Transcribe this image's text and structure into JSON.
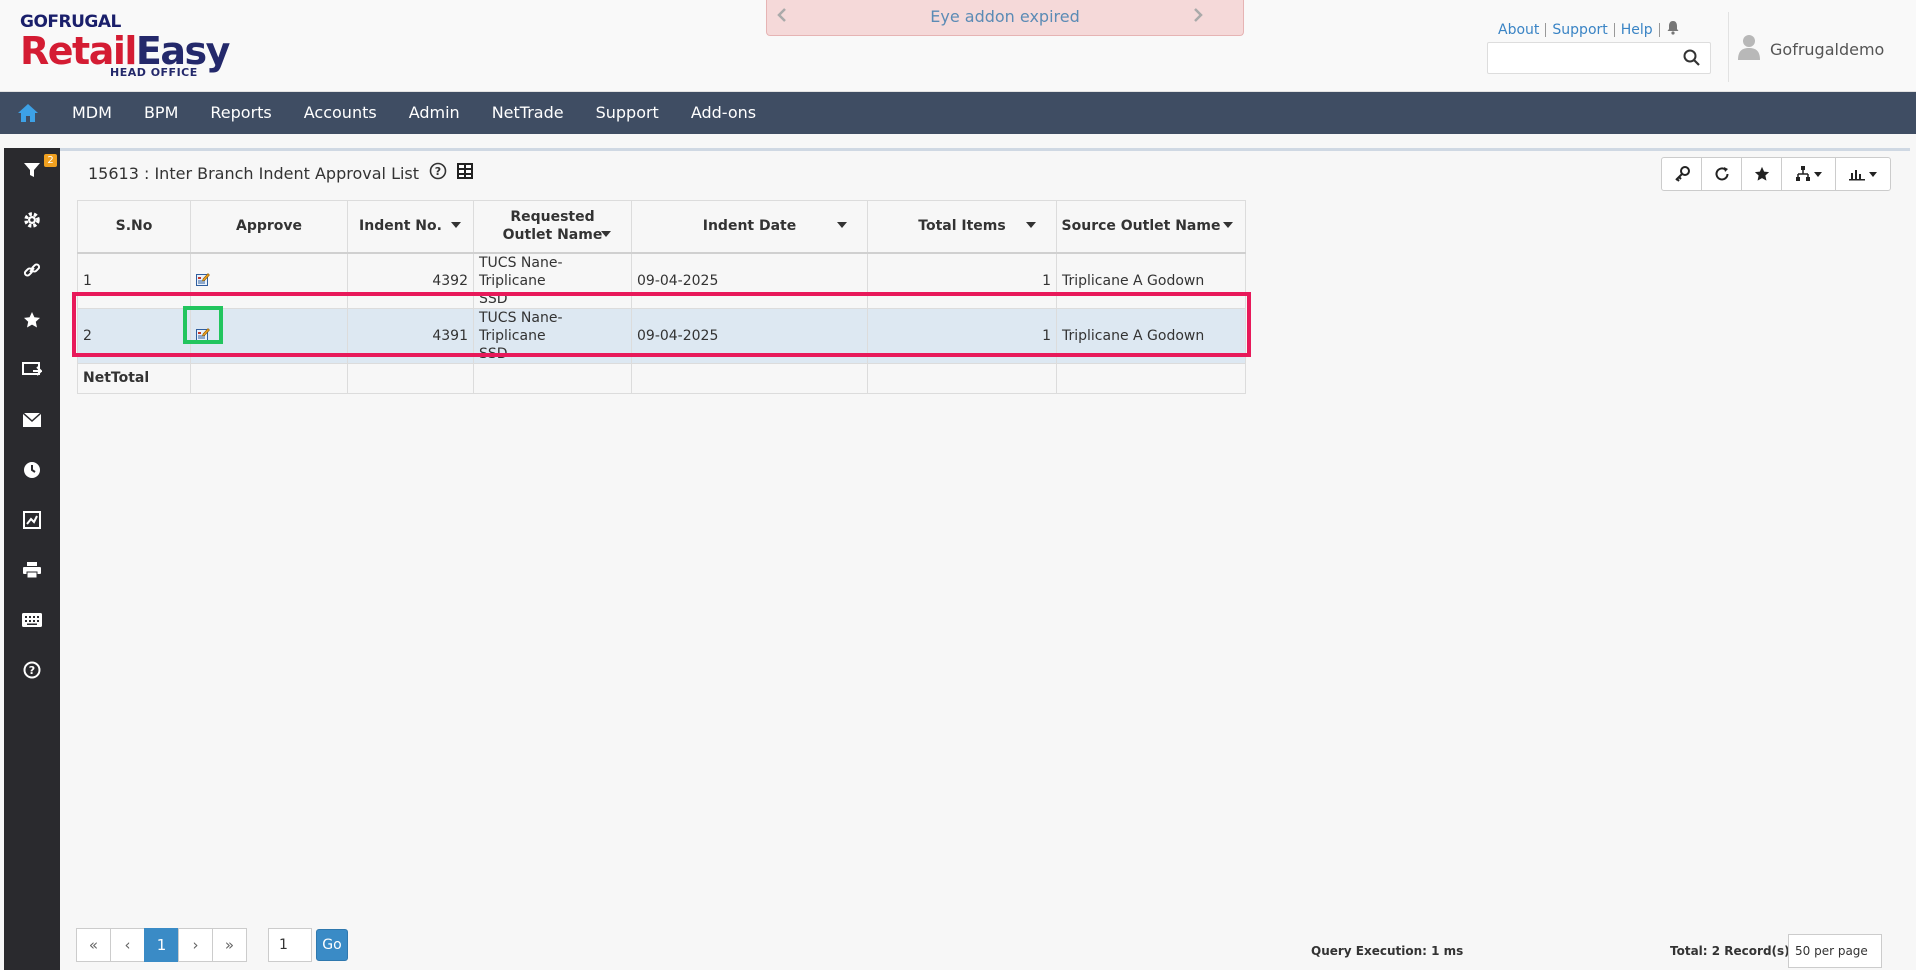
{
  "header": {
    "logo_brand": "GOFRUGAL",
    "logo_retail": "Retail",
    "logo_easy": "Easy",
    "logo_sub": "HEAD OFFICE",
    "notice": "Eye addon expired",
    "links": [
      "About",
      "Support",
      "Help"
    ],
    "search_placeholder": "",
    "username": "Gofrugaldemo"
  },
  "nav": {
    "items": [
      "MDM",
      "BPM",
      "Reports",
      "Accounts",
      "Admin",
      "NetTrade",
      "Support",
      "Add-ons"
    ]
  },
  "sidebar": {
    "filter_badge": "2"
  },
  "page": {
    "title": "15613 : Inter Branch Indent Approval List"
  },
  "table": {
    "headers": {
      "sno": "S.No",
      "approve": "Approve",
      "indent_no": "Indent No.",
      "requested_outlet": "Requested Outlet Name",
      "indent_date": "Indent Date",
      "total_items": "Total Items",
      "source_outlet": "Source Outlet Name"
    },
    "rows": [
      {
        "sno": "1",
        "indent_no": "4392",
        "requested_outlet_line1": "TUCS Nane- Triplicane",
        "requested_outlet_line2": "SSD",
        "indent_date": "09-04-2025",
        "total_items": "1",
        "source_outlet": "Triplicane A Godown"
      },
      {
        "sno": "2",
        "indent_no": "4391",
        "requested_outlet_line1": "TUCS Nane- Triplicane",
        "requested_outlet_line2": "SSD",
        "indent_date": "09-04-2025",
        "total_items": "1",
        "source_outlet": "Triplicane A Godown"
      }
    ],
    "footer_label": "NetTotal"
  },
  "pagination": {
    "first": "«",
    "prev": "‹",
    "current": "1",
    "next": "›",
    "last": "»",
    "page_input": "1",
    "go": "Go",
    "query_exec": "Query Execution: 1 ms",
    "total": "Total: 2 Record(s)",
    "per_page": "50 per page"
  },
  "colors": {
    "nav_bg": "#3f4d63",
    "sidebar_bg": "#2a2a2e",
    "accent": "#3a8bc6",
    "selected_row": "#dde8f2",
    "highlight_red": "#e8195a",
    "highlight_green": "#22c55e"
  }
}
